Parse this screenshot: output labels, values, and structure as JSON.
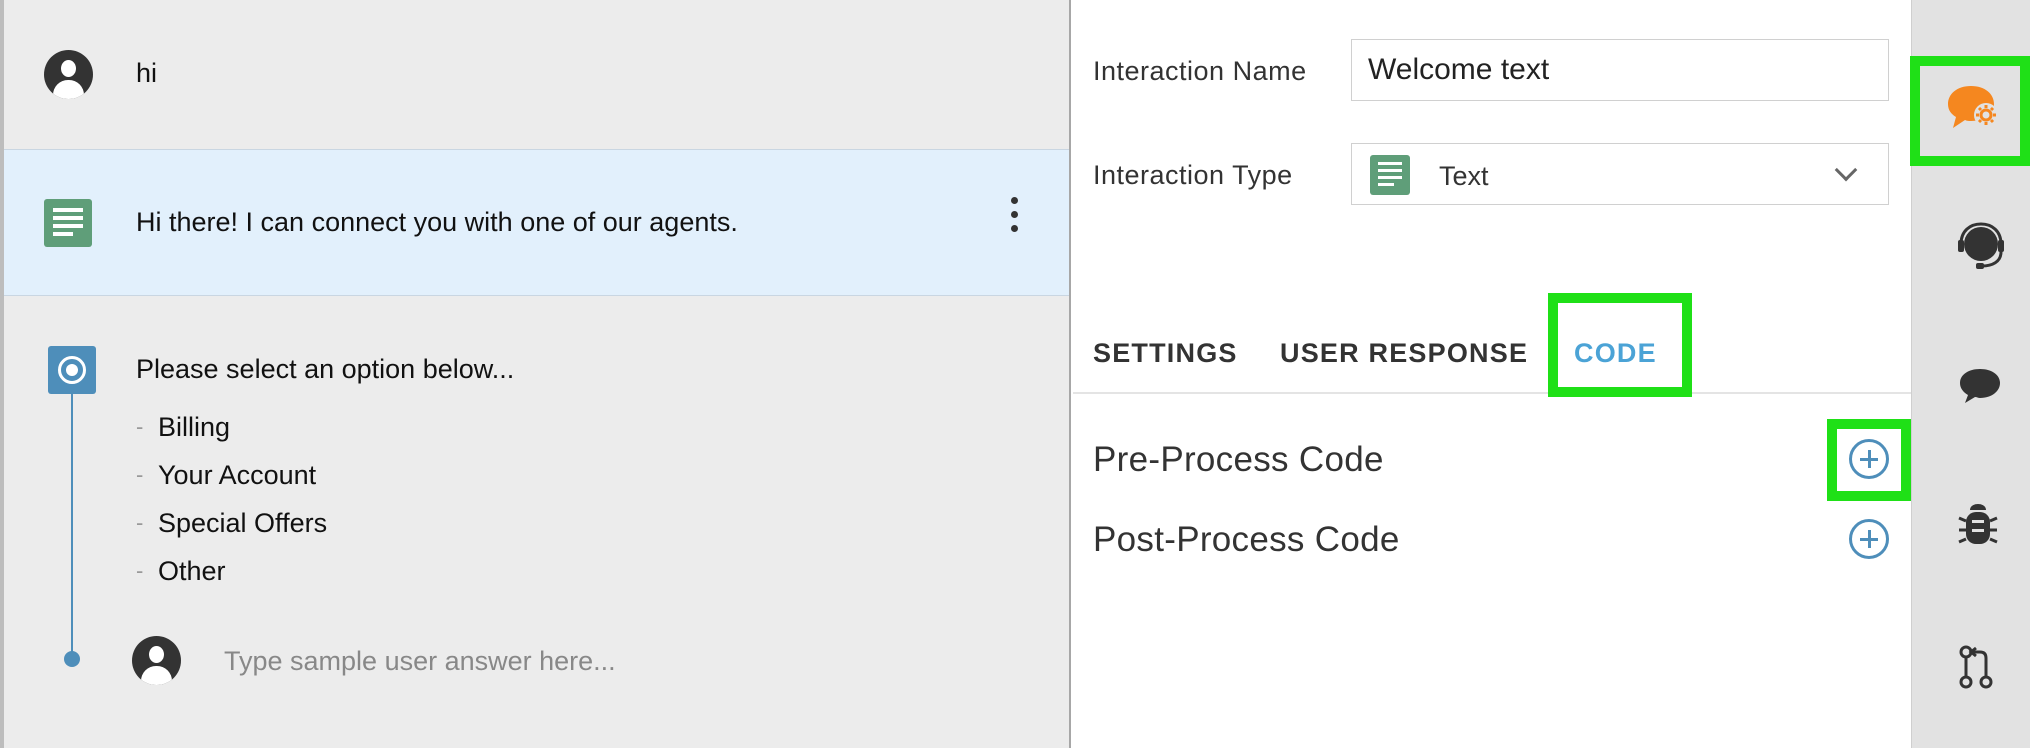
{
  "flow": {
    "user_message": "hi",
    "bot_message": "Hi there! I can connect you with one of our agents.",
    "question": {
      "text": "Please select an option below...",
      "options": [
        "Billing",
        "Your Account",
        "Special Offers",
        "Other"
      ]
    },
    "sample_answer_placeholder": "Type sample user answer here..."
  },
  "panel": {
    "name_label": "Interaction Name",
    "name_value": "Welcome text",
    "type_label": "Interaction Type",
    "type_value": "Text",
    "tabs": [
      {
        "label": "SETTINGS",
        "active": false
      },
      {
        "label": "USER RESPONSE",
        "active": false
      },
      {
        "label": "CODE",
        "active": true
      }
    ],
    "code_items": [
      {
        "label": "Pre-Process Code"
      },
      {
        "label": "Post-Process Code"
      }
    ]
  },
  "toolbar": {
    "items": [
      "chat-settings-icon",
      "agent-headset-icon",
      "chat-bubble-icon",
      "bug-icon",
      "branch-merge-icon"
    ]
  },
  "colors": {
    "accent": "#4ba3d6",
    "active_tool": "#f5871f",
    "highlight": "#1fe017",
    "bot_row_bg": "#e2f0fc",
    "text_icon": "#5f9e79",
    "question_icon": "#4e8eba"
  }
}
